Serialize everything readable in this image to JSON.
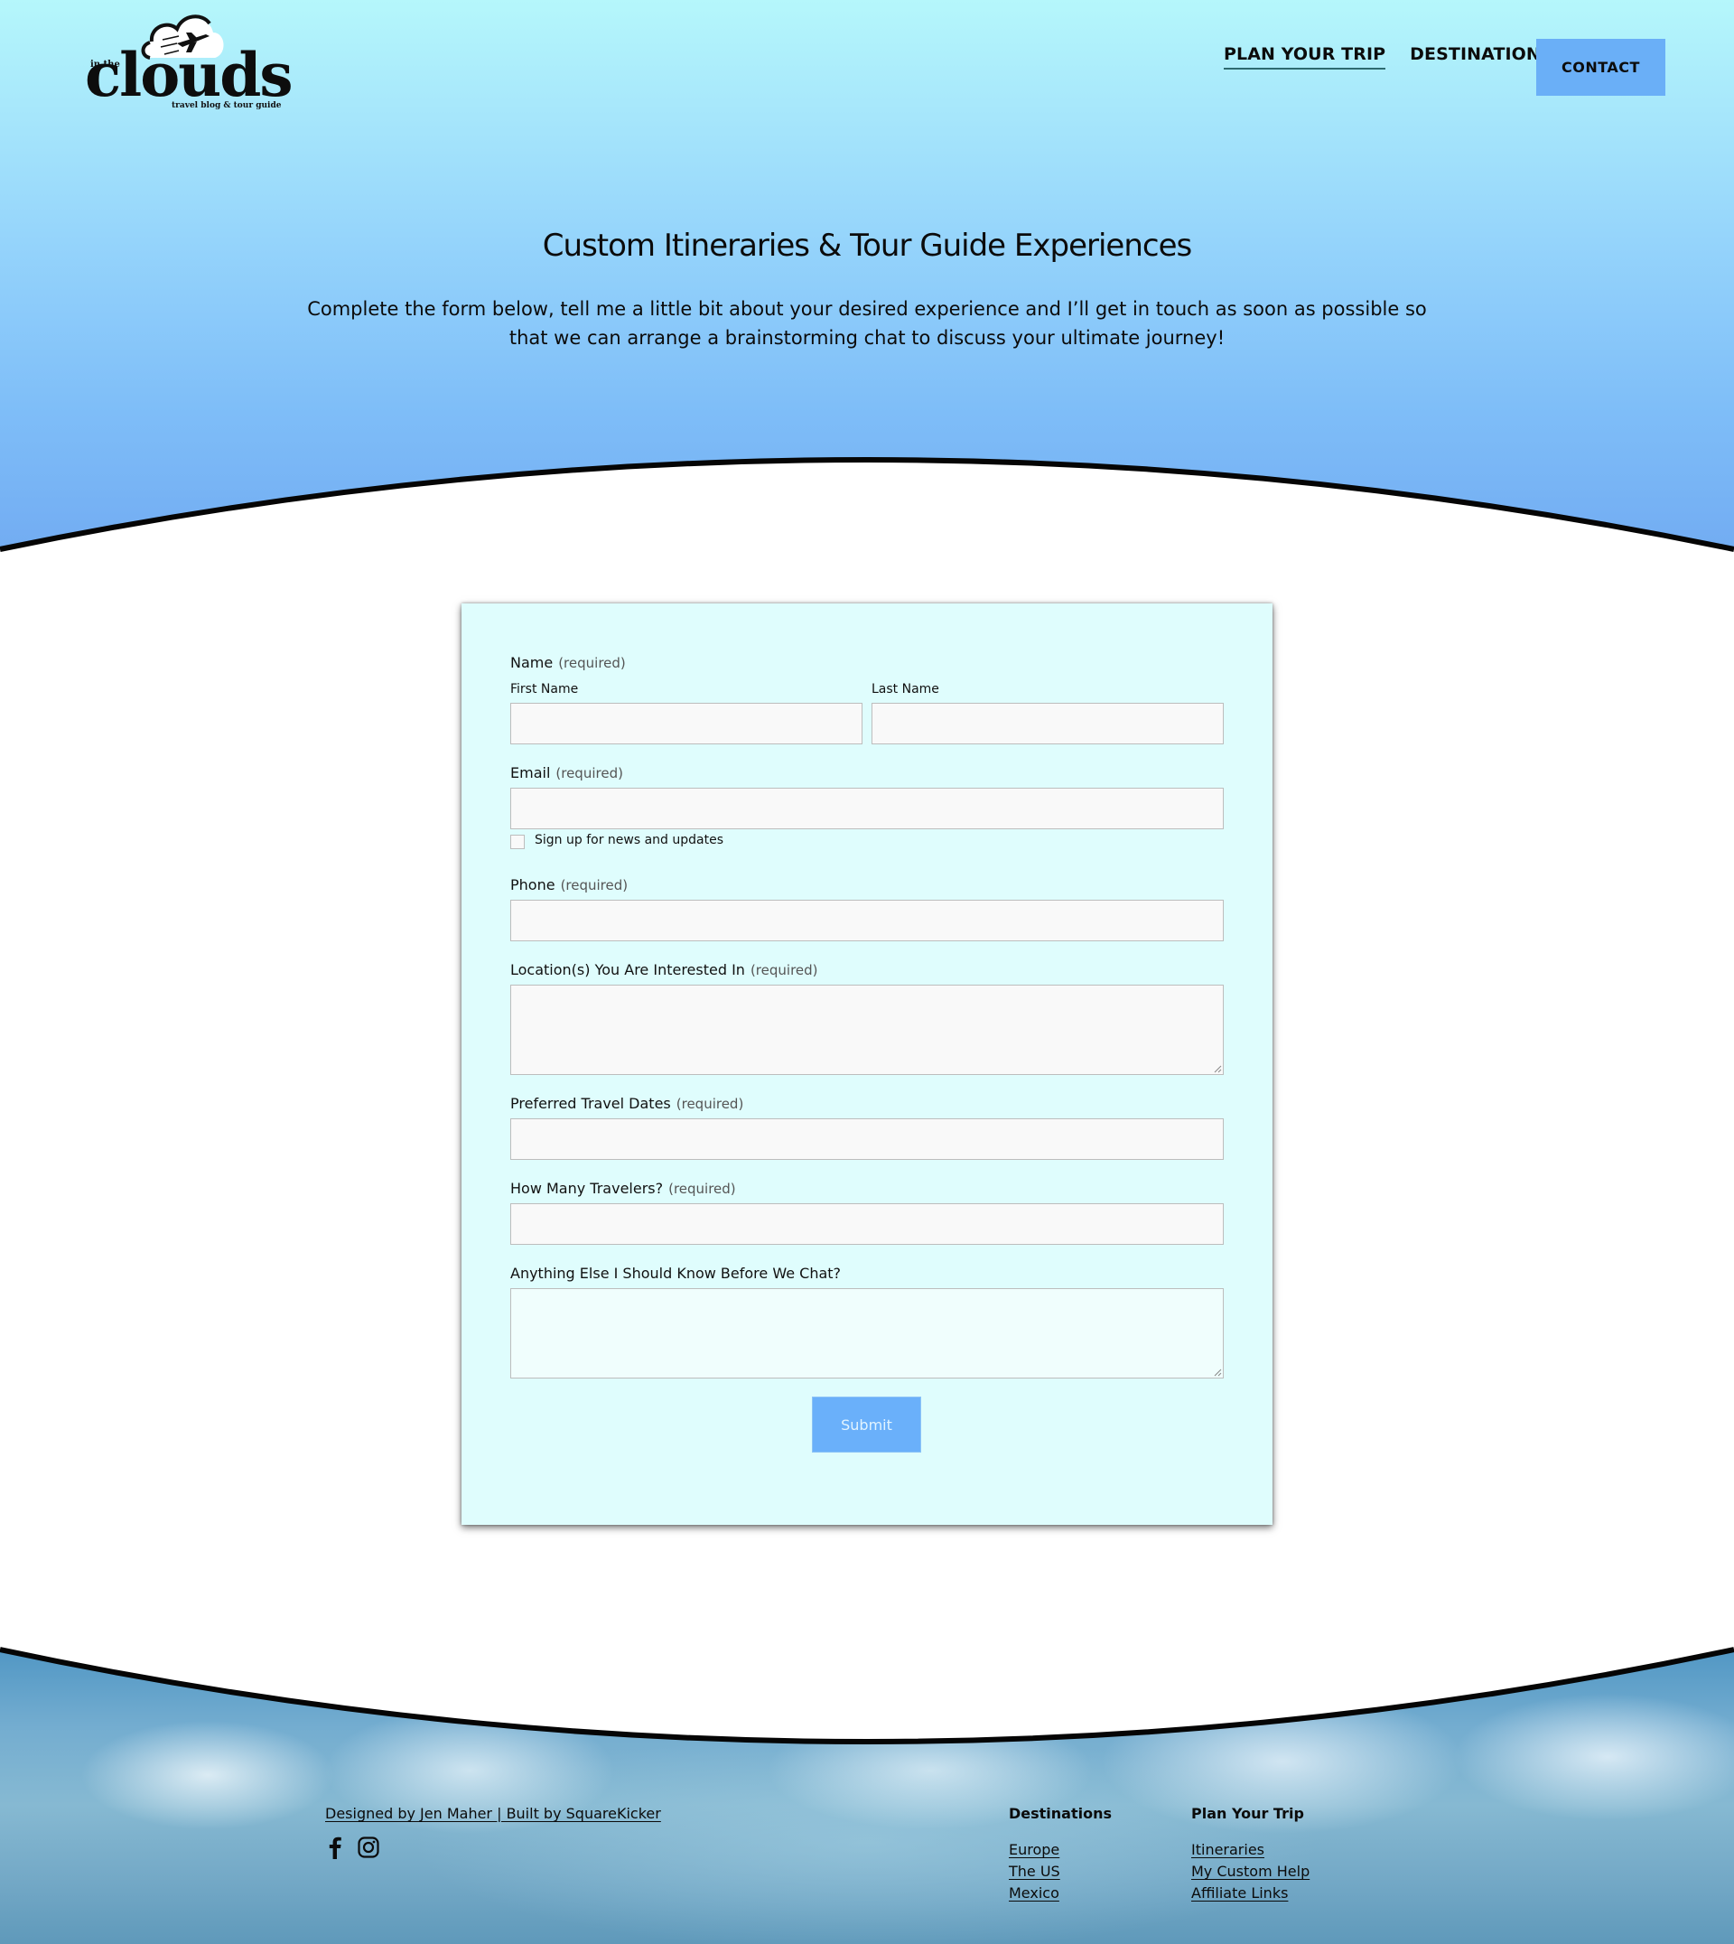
{
  "header": {
    "logo": {
      "small_text": "in the",
      "word": "clouds",
      "tagline": "travel blog & tour guide"
    },
    "nav": {
      "plan_your_trip": "PLAN YOUR TRIP",
      "destinations": "DESTINATIONS",
      "contact": "CONTACT"
    }
  },
  "hero": {
    "title": "Custom Itineraries & Tour Guide Experiences",
    "description": "Complete the form below, tell me a little bit about your desired experience and I’ll get in touch as soon as possible so that we can arrange a brainstorming chat to discuss your ultimate journey!"
  },
  "form": {
    "name": {
      "label": "Name",
      "required": "(required)",
      "first_label": "First Name",
      "first_value": "",
      "last_label": "Last Name",
      "last_value": ""
    },
    "email": {
      "label": "Email",
      "required": "(required)",
      "value": ""
    },
    "newsletter": {
      "label": "Sign up for news and updates",
      "checked": false
    },
    "phone": {
      "label": "Phone",
      "required": "(required)",
      "value": ""
    },
    "locations": {
      "label": "Location(s) You Are Interested In",
      "required": "(required)",
      "value": ""
    },
    "dates": {
      "label": "Preferred Travel Dates",
      "required": "(required)",
      "value": ""
    },
    "travelers": {
      "label": "How Many Travelers?",
      "required": "(required)",
      "value": ""
    },
    "notes": {
      "label": "Anything Else I Should Know Before We Chat?",
      "value": ""
    },
    "submit_label": "Submit"
  },
  "footer": {
    "credit": "Designed by Jen Maher | Built by SquareKicker",
    "social": [
      "facebook-icon",
      "instagram-icon"
    ],
    "columns": [
      {
        "heading": "Destinations",
        "links": [
          "Europe",
          "The US",
          "Mexico"
        ]
      },
      {
        "heading": "Plan Your Trip",
        "links": [
          "Itineraries",
          "My Custom Help",
          "Affiliate Links"
        ]
      }
    ]
  },
  "colors": {
    "accent_blue": "#6aaff7",
    "form_background": "#dffdfd",
    "hero_top": "#b5f7fb",
    "hero_bottom": "#72acf2"
  }
}
